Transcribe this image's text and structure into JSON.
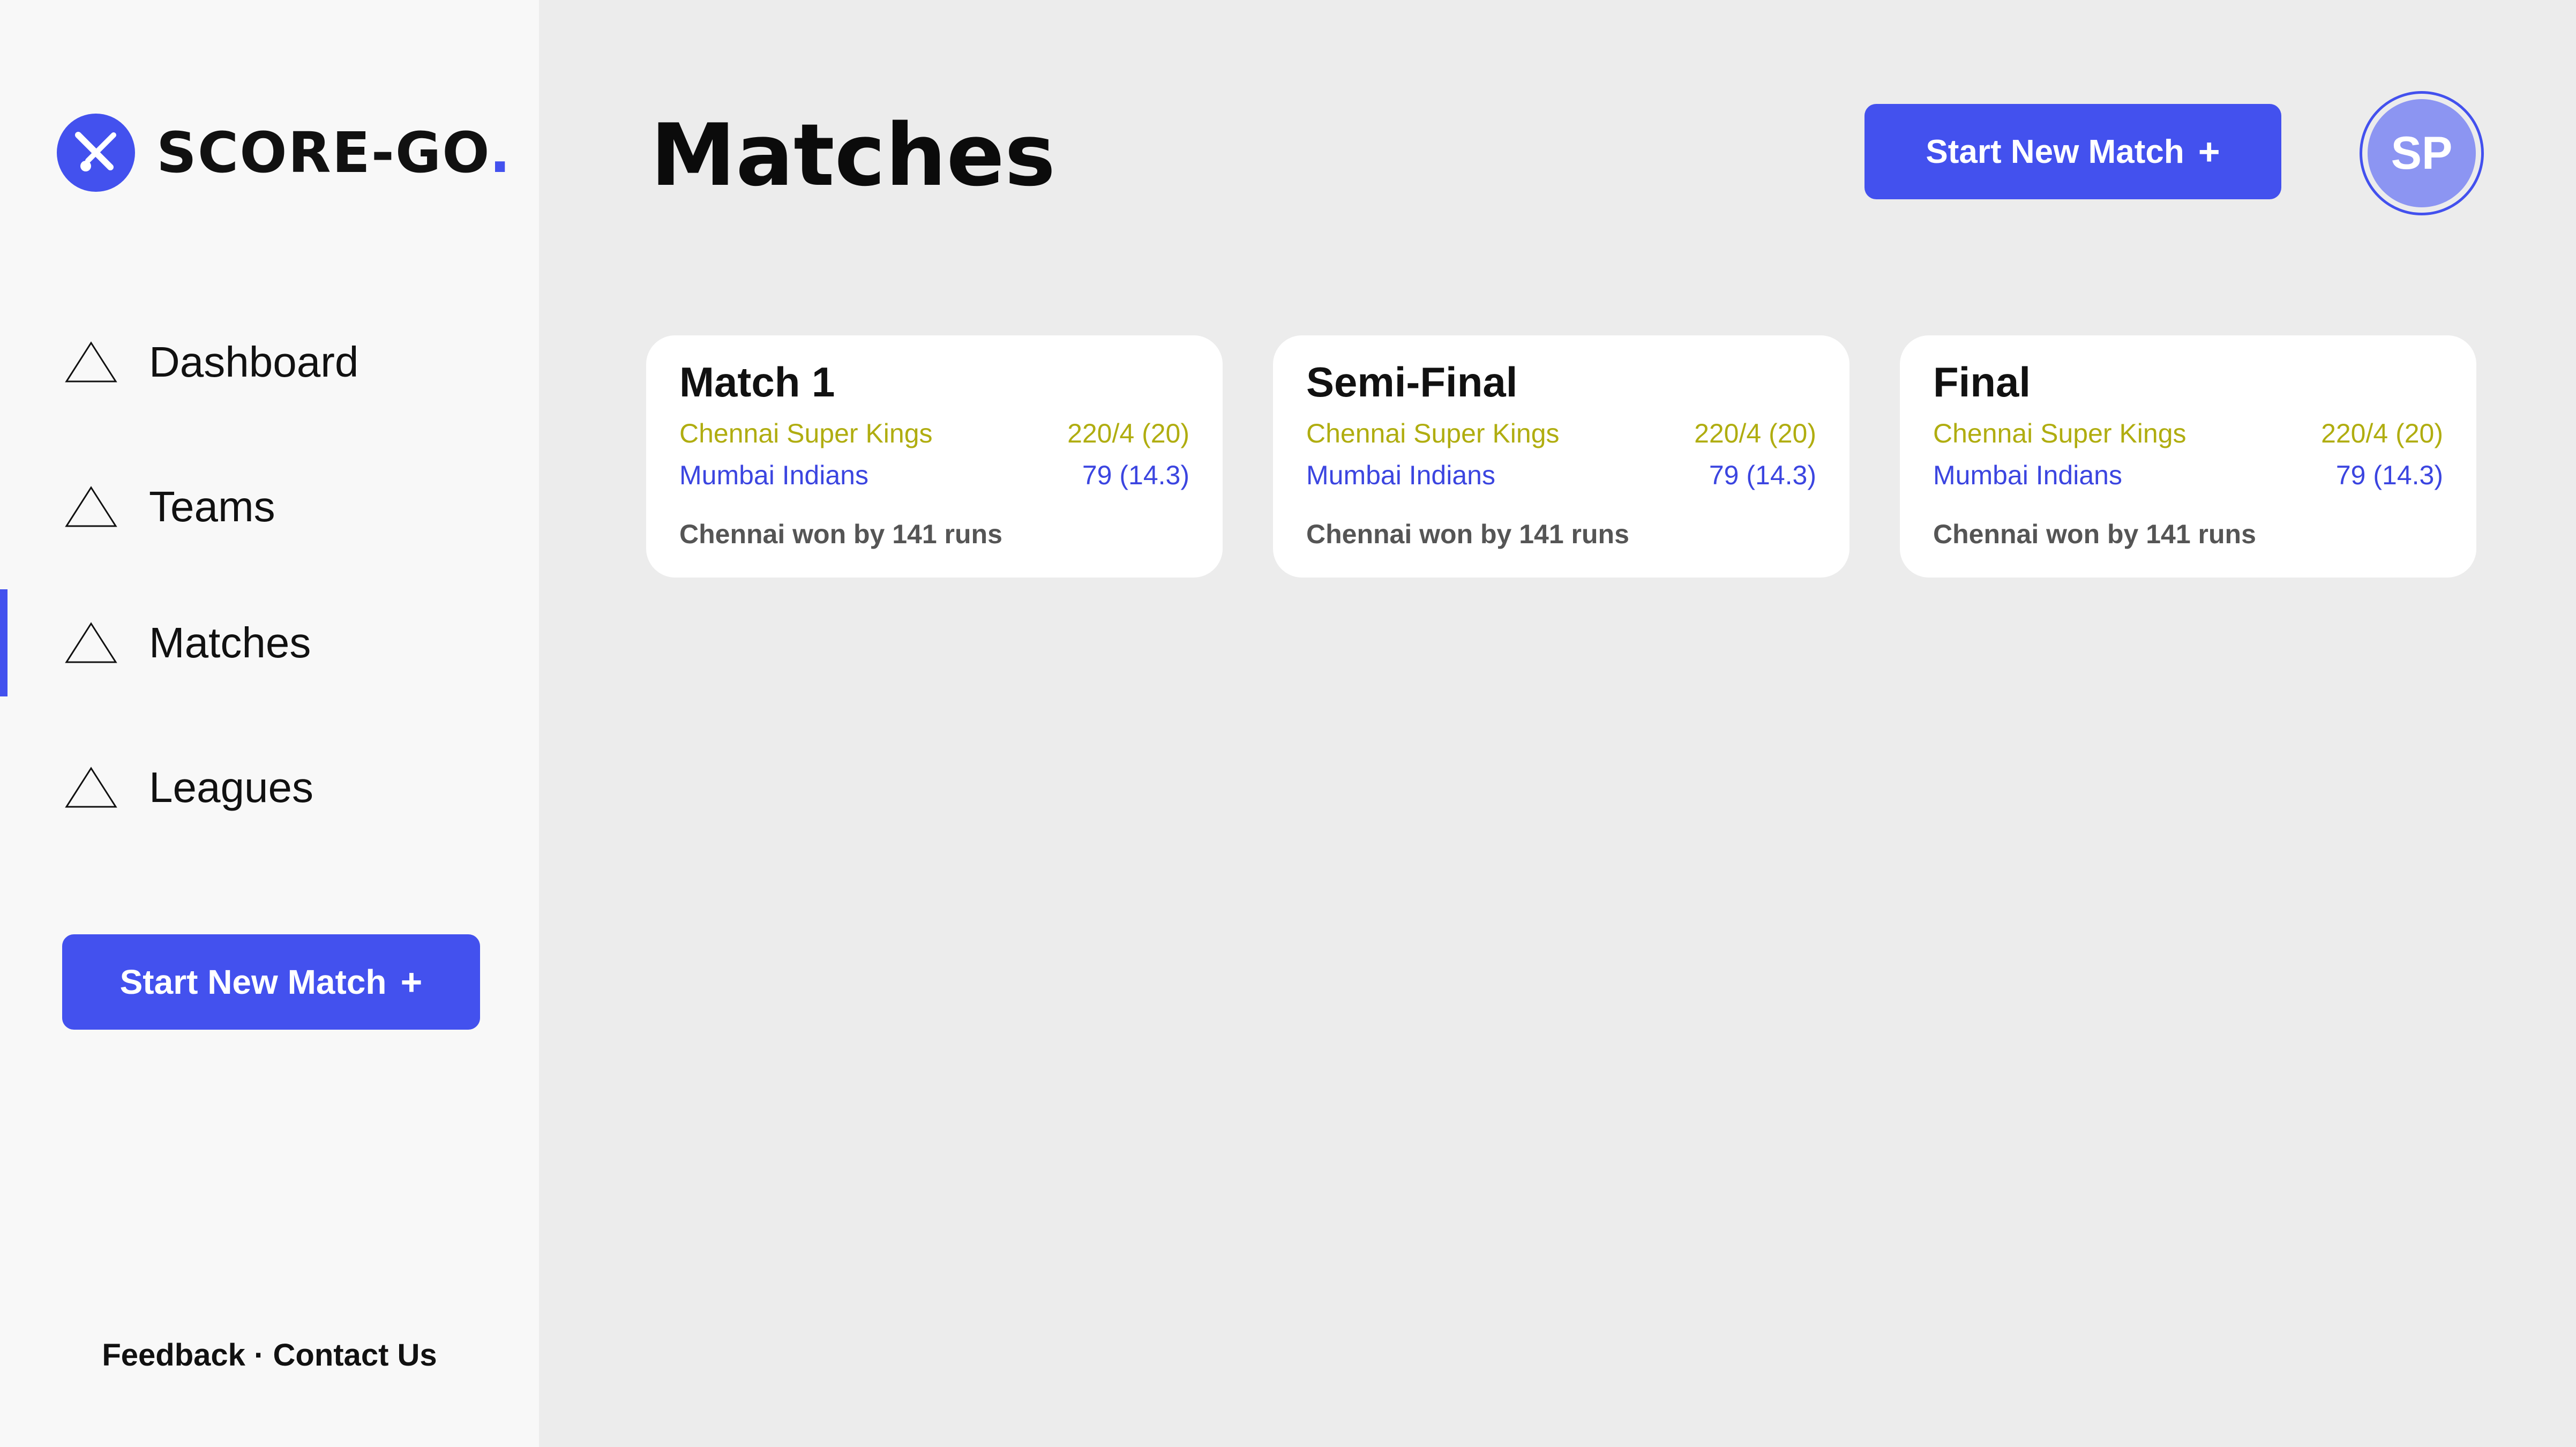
{
  "brand": {
    "name": "SCORE-GO",
    "dot": ".",
    "accent_color": "#4351ee"
  },
  "sidebar": {
    "items": [
      {
        "label": "Dashboard",
        "icon": "triangle-icon",
        "active": false
      },
      {
        "label": "Teams",
        "icon": "triangle-icon",
        "active": false
      },
      {
        "label": "Matches",
        "icon": "triangle-icon",
        "active": true
      },
      {
        "label": "Leagues",
        "icon": "triangle-icon",
        "active": false
      }
    ],
    "start_button": {
      "label": "Start New Match",
      "plus": "+"
    },
    "footer": {
      "feedback": "Feedback",
      "separator": "·",
      "contact": "Contact Us"
    }
  },
  "header": {
    "title": "Matches",
    "start_button": {
      "label": "Start New Match",
      "plus": "+"
    },
    "avatar_initials": "SP"
  },
  "matches": [
    {
      "title": "Match 1",
      "team1": {
        "name": "Chennai Super Kings",
        "score": "220/4 (20)"
      },
      "team2": {
        "name": "Mumbai Indians",
        "score": "79 (14.3)"
      },
      "result": "Chennai won by 141 runs"
    },
    {
      "title": "Semi-Final",
      "team1": {
        "name": "Chennai Super Kings",
        "score": "220/4 (20)"
      },
      "team2": {
        "name": "Mumbai Indians",
        "score": "79 (14.3)"
      },
      "result": "Chennai won by 141 runs"
    },
    {
      "title": "Final",
      "team1": {
        "name": "Chennai Super Kings",
        "score": "220/4 (20)"
      },
      "team2": {
        "name": "Mumbai Indians",
        "score": "79 (14.3)"
      },
      "result": "Chennai won by 141 runs"
    }
  ],
  "colors": {
    "team1": "#b0ad10",
    "team2": "#3b45e0",
    "background": "#ececec",
    "sidebar": "#f8f8f8"
  }
}
